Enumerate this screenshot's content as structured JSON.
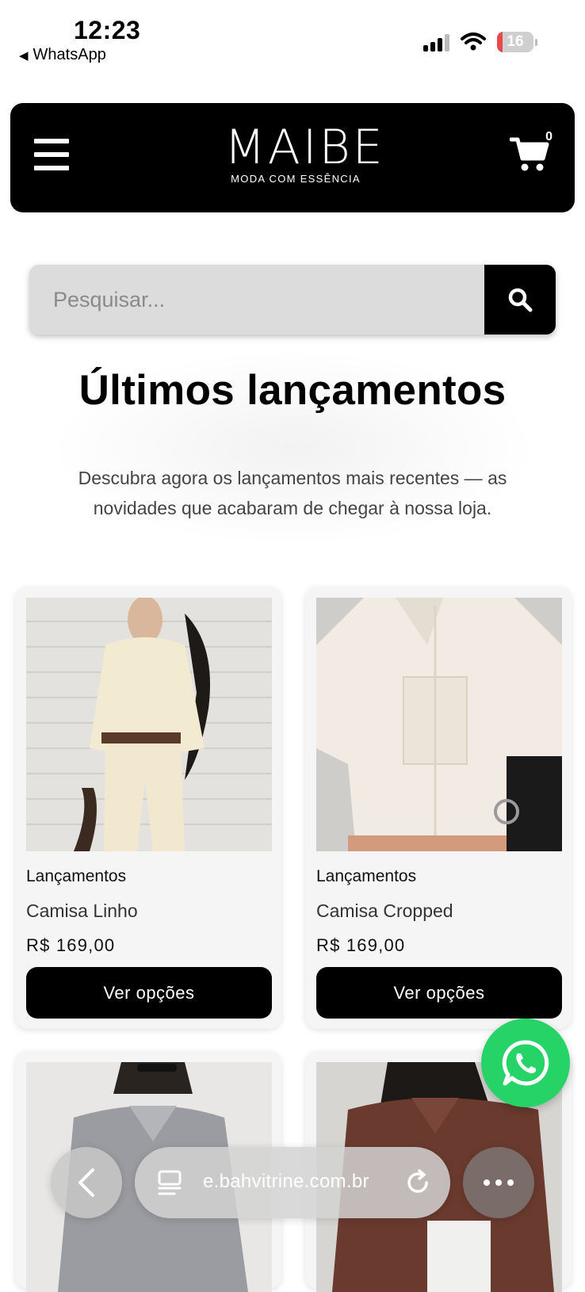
{
  "status_bar": {
    "time": "12:23",
    "back_app": "WhatsApp",
    "battery": "16",
    "battery_color": "#e5484d"
  },
  "header": {
    "logo_word": "MAIBE",
    "logo_tagline": "MODA COM ESSÊNCIA",
    "cart_count": "0",
    "menu_icon": "hamburger-icon",
    "cart_icon": "cart-icon"
  },
  "search": {
    "placeholder": "Pesquisar...",
    "value": "",
    "icon": "search-icon"
  },
  "section": {
    "title": "Últimos lançamentos",
    "subtitle": "Descubra agora os lançamentos mais recentes — as novidades que acabaram de chegar à nossa loja."
  },
  "products": [
    {
      "category": "Lançamentos",
      "name": "Camisa Linho",
      "price": "R$ 169,00",
      "button": "Ver opções"
    },
    {
      "category": "Lançamentos",
      "name": "Camisa Cropped",
      "price": "R$ 169,00",
      "button": "Ver opções"
    }
  ],
  "whatsapp_fab": {
    "icon": "whatsapp-icon",
    "color": "#25d366"
  },
  "browser": {
    "url": "e.bahvitrine.com.br",
    "back_icon": "chevron-left-icon",
    "tabs_icon": "tabs-icon",
    "reload_icon": "reload-icon",
    "more_icon": "more-icon"
  }
}
